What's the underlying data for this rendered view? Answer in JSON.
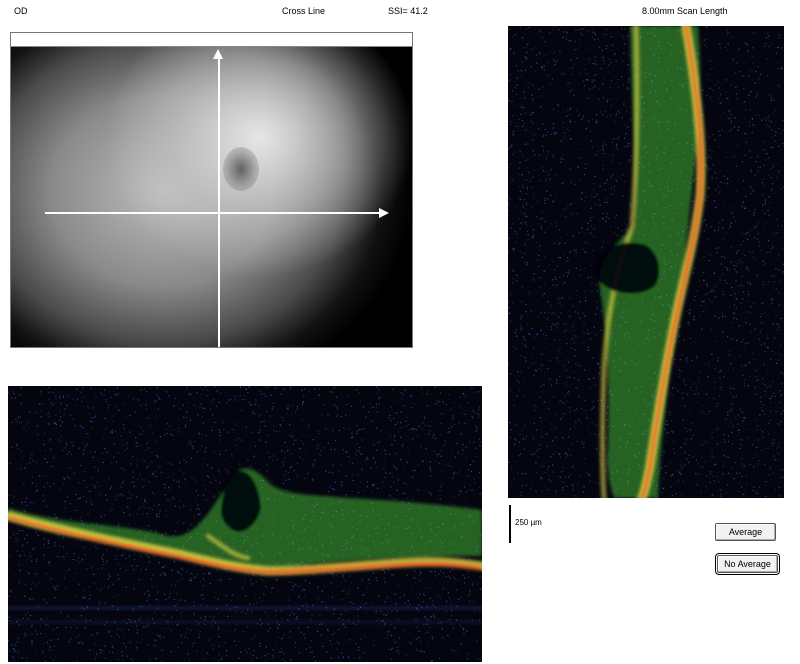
{
  "header": {
    "eye": "OD",
    "scan_pattern": "Cross Line",
    "ssi": "SSI= 41.2",
    "scan_length": "8.00mm Scan Length"
  },
  "scale": {
    "label": "250 µm"
  },
  "buttons": {
    "average": "Average",
    "no_average": "No Average"
  },
  "colors": {
    "background": "#ffffff",
    "oct_background": "#050510",
    "oct_low": "#3a68c8",
    "oct_mid": "#4fd43a",
    "oct_high": "#f2e44a",
    "oct_peak": "#ff3a1e",
    "crosshair": "#ffffff"
  }
}
